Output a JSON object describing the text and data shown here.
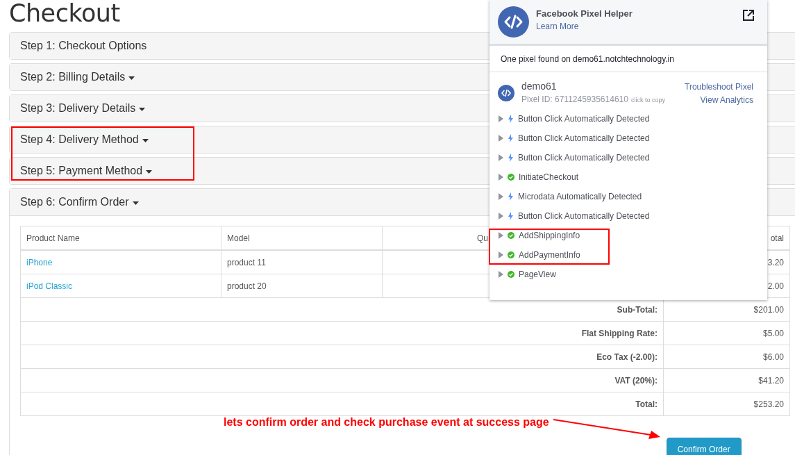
{
  "page": {
    "title": "Checkout"
  },
  "steps": [
    {
      "label": "Step 1: Checkout Options",
      "expandable": false,
      "expanded": false,
      "highlighted": false
    },
    {
      "label": "Step 2: Billing Details",
      "expandable": true,
      "expanded": false,
      "highlighted": false
    },
    {
      "label": "Step 3: Delivery Details",
      "expandable": true,
      "expanded": false,
      "highlighted": false
    },
    {
      "label": "Step 4: Delivery Method",
      "expandable": true,
      "expanded": false,
      "highlighted": true
    },
    {
      "label": "Step 5: Payment Method",
      "expandable": true,
      "expanded": false,
      "highlighted": true
    },
    {
      "label": "Step 6: Confirm Order",
      "expandable": true,
      "expanded": true,
      "highlighted": false
    }
  ],
  "order": {
    "columns": [
      "Product Name",
      "Model",
      "Qu",
      "otal"
    ],
    "rows": [
      {
        "product": "iPhone",
        "model": "product 11",
        "total": "3.20"
      },
      {
        "product": "iPod Classic",
        "model": "product 20",
        "total": "2.00"
      }
    ],
    "totals": [
      {
        "label": "Sub-Total:",
        "value": "$201.00"
      },
      {
        "label": "Flat Shipping Rate:",
        "value": "$5.00"
      },
      {
        "label": "Eco Tax (-2.00):",
        "value": "$6.00"
      },
      {
        "label": "VAT (20%):",
        "value": "$41.20"
      },
      {
        "label": "Total:",
        "value": "$253.20"
      }
    ],
    "button": "Confirm Order"
  },
  "annotation": {
    "text": "lets confirm order and check purchase event at success page"
  },
  "pixel_helper": {
    "title": "Facebook Pixel Helper",
    "learn_more": "Learn More",
    "summary": "One pixel found on demo61.notchtechnology.in",
    "pixel": {
      "name": "demo61",
      "id_text": "Pixel ID: 6711245935614610",
      "copy_hint": "click to copy",
      "links": [
        "Troubleshoot Pixel",
        "View Analytics"
      ]
    },
    "events": [
      {
        "label": "Button Click Automatically Detected",
        "kind": "auto",
        "highlighted": false
      },
      {
        "label": "Button Click Automatically Detected",
        "kind": "auto",
        "highlighted": false
      },
      {
        "label": "Button Click Automatically Detected",
        "kind": "auto",
        "highlighted": false
      },
      {
        "label": "InitiateCheckout",
        "kind": "standard",
        "highlighted": false
      },
      {
        "label": "Microdata Automatically Detected",
        "kind": "auto",
        "highlighted": false
      },
      {
        "label": "Button Click Automatically Detected",
        "kind": "auto",
        "highlighted": false
      },
      {
        "label": "AddShippingInfo",
        "kind": "standard",
        "highlighted": true
      },
      {
        "label": "AddPaymentInfo",
        "kind": "standard",
        "highlighted": true
      },
      {
        "label": "PageView",
        "kind": "standard",
        "highlighted": false
      }
    ]
  }
}
